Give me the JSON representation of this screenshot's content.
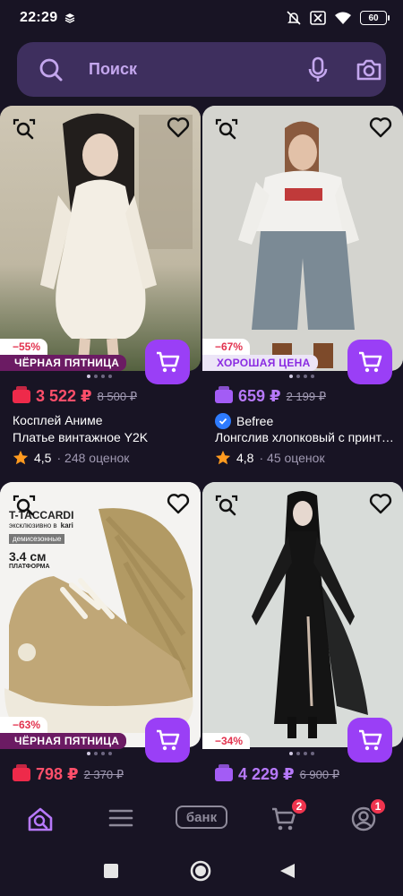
{
  "status_bar": {
    "time": "22:29",
    "battery": "60"
  },
  "search": {
    "placeholder": "Поиск"
  },
  "products": [
    {
      "discount": "−55%",
      "promo": "ЧЁРНАЯ ПЯТНИЦА",
      "price": "3 522 ₽",
      "old_price": "8 500 ₽",
      "brand": "Косплей Аниме",
      "title": "Платье винтажное Y2K",
      "rating": "4,5",
      "reviews": "248 оценок"
    },
    {
      "discount": "−67%",
      "promo": "ХОРОШАЯ ЦЕНА",
      "price": "659 ₽",
      "old_price": "2 199 ₽",
      "brand": "Befree",
      "title": "Лонгслив хлопковый с принтом",
      "rating": "4,8",
      "reviews": "45 оценок"
    },
    {
      "discount": "−63%",
      "promo": "ЧЁРНАЯ ПЯТНИЦА",
      "price": "798 ₽",
      "old_price": "2 370 ₽",
      "photo_text": {
        "brand": "T-TACCARDI",
        "exclusive": "эксклюзивно в",
        "store": "kari",
        "season": "демисезонные",
        "height": "3.4 см",
        "platform": "ПЛАТФОРМА"
      }
    },
    {
      "discount": "−34%",
      "price": "4 229 ₽",
      "old_price": "6 900 ₽"
    }
  ],
  "bottom_nav": {
    "bank_label": "банк",
    "cart_badge": "2",
    "profile_badge": "1"
  },
  "colors": {
    "background": "#181424",
    "search_bg": "#3e2f5e",
    "accent": "#9a3ff6",
    "sale_red": "#ff4f6a",
    "sale_violet": "#b779fb",
    "promo_black": "#6b1b63"
  }
}
